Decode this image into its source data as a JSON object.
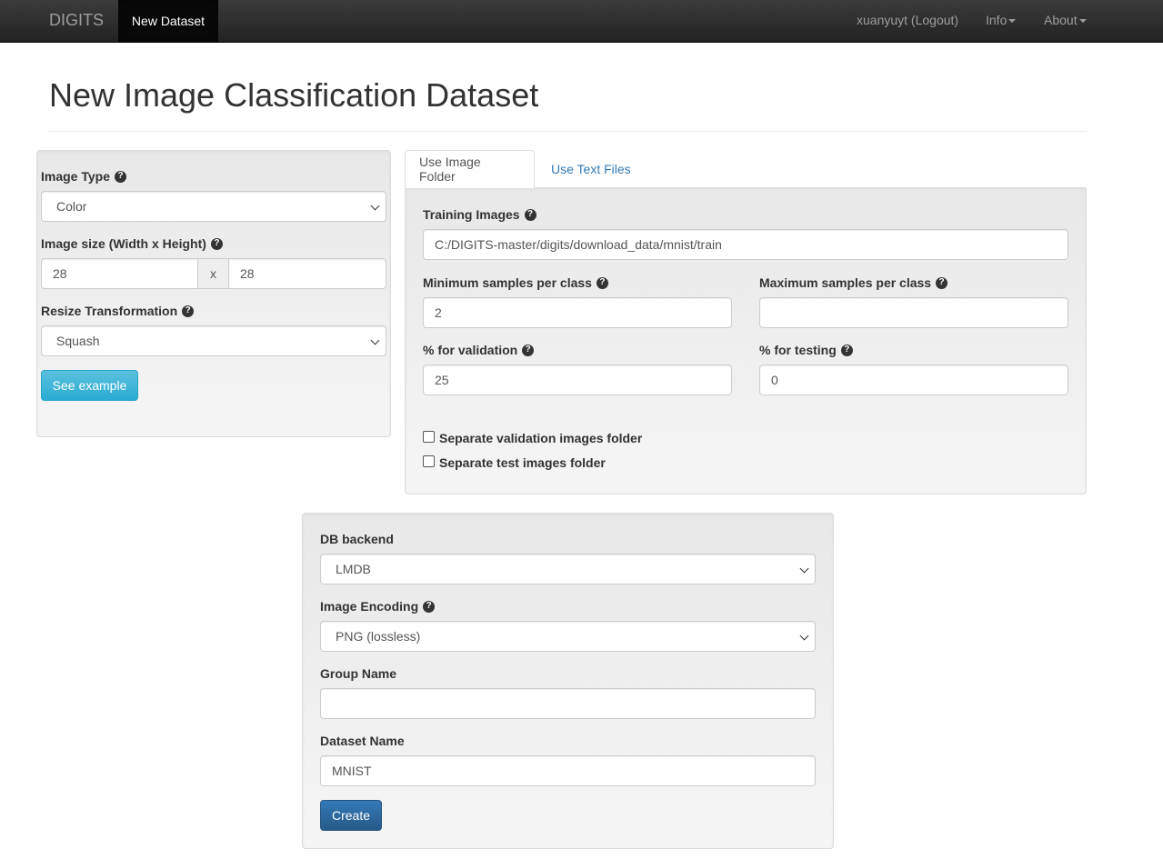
{
  "navbar": {
    "brand": "DIGITS",
    "active_item": "New Dataset",
    "user": "xuanyuyt (Logout)",
    "info": "Info",
    "about": "About"
  },
  "page": {
    "title": "New Image Classification Dataset"
  },
  "image_settings": {
    "image_type_label": "Image Type",
    "image_type_value": "Color",
    "image_size_label": "Image size (Width x Height)",
    "width": "28",
    "size_separator": "x",
    "height": "28",
    "resize_label": "Resize Transformation",
    "resize_value": "Squash",
    "see_example": "See example"
  },
  "tabs": {
    "folder": "Use Image Folder",
    "text_files": "Use Text Files"
  },
  "folder_form": {
    "training_images_label": "Training Images",
    "training_images_value": "C:/DIGITS-master/digits/download_data/mnist/train",
    "min_samples_label": "Minimum samples per class",
    "min_samples_value": "2",
    "max_samples_label": "Maximum samples per class",
    "max_samples_value": "",
    "validation_label": "% for validation",
    "validation_value": "25",
    "testing_label": "% for testing",
    "testing_value": "0",
    "separate_validation": "Separate validation images folder",
    "separate_test": "Separate test images folder"
  },
  "db_form": {
    "backend_label": "DB backend",
    "backend_value": "LMDB",
    "encoding_label": "Image Encoding",
    "encoding_value": "PNG (lossless)",
    "group_label": "Group Name",
    "group_value": "",
    "dataset_label": "Dataset Name",
    "dataset_value": "MNIST",
    "create": "Create"
  },
  "icons": {
    "help": "?"
  }
}
